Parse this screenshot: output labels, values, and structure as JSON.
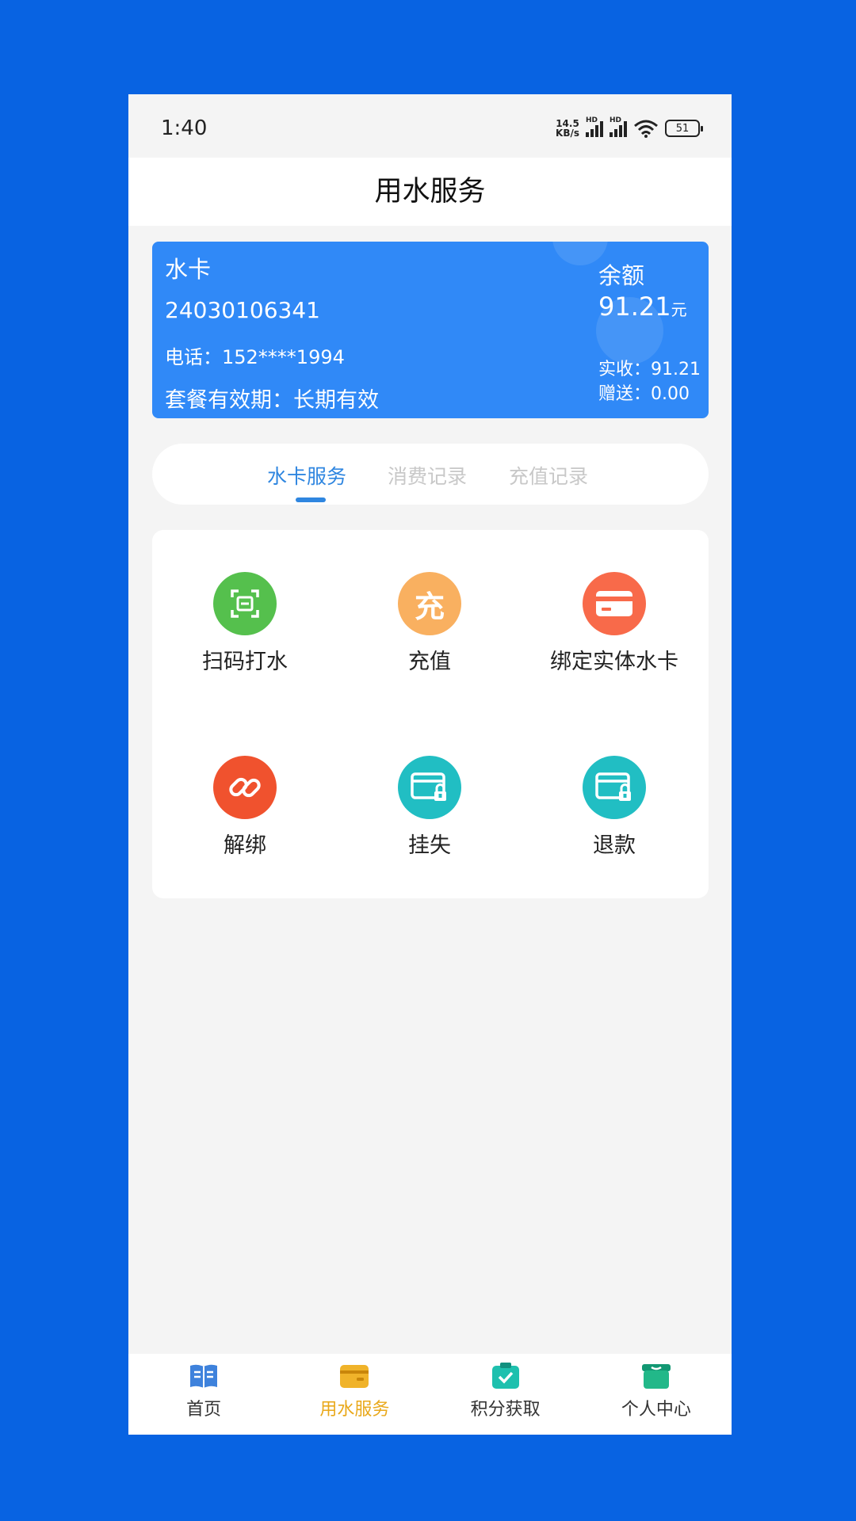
{
  "status_bar": {
    "time": "1:40",
    "net_speed_value": "14.5",
    "net_speed_unit": "KB/s",
    "sim1_tag": "HD",
    "sim2_tag": "HD",
    "battery": "51"
  },
  "header": {
    "title": "用水服务"
  },
  "card": {
    "title": "水卡",
    "number": "24030106341",
    "phone": "电话：152****1994",
    "validity": "套餐有效期：长期有效",
    "balance_label": "余额",
    "balance_value": "91.21",
    "balance_unit": "元",
    "paid": "实收：91.21",
    "bonus": "赠送：0.00",
    "color": "#3089F7"
  },
  "tabs": [
    {
      "label": "水卡服务",
      "active": true
    },
    {
      "label": "消费记录",
      "active": false
    },
    {
      "label": "充值记录",
      "active": false
    }
  ],
  "services": [
    {
      "label": "扫码打水",
      "icon": "scan-icon",
      "color": "#55C04D"
    },
    {
      "label": "充值",
      "icon": "recharge-icon",
      "icon_text": "充",
      "color": "#F9B060"
    },
    {
      "label": "绑定实体水卡",
      "icon": "card-icon",
      "color": "#F86A4A"
    },
    {
      "label": "解绑",
      "icon": "unlink-icon",
      "color": "#F0522E"
    },
    {
      "label": "挂失",
      "icon": "card-lock-icon",
      "color": "#21BEC3"
    },
    {
      "label": "退款",
      "icon": "card-lock-icon",
      "color": "#21BEC3"
    }
  ],
  "bottom_nav": [
    {
      "label": "首页",
      "icon": "book-icon",
      "active": false
    },
    {
      "label": "用水服务",
      "icon": "wallet-icon",
      "active": true
    },
    {
      "label": "积分获取",
      "icon": "clipboard-check-icon",
      "active": false
    },
    {
      "label": "个人中心",
      "icon": "box-icon",
      "active": false
    }
  ],
  "colors": {
    "background": "#0863E2",
    "accent": "#2F86E0",
    "nav_active": "#E9A81A"
  }
}
